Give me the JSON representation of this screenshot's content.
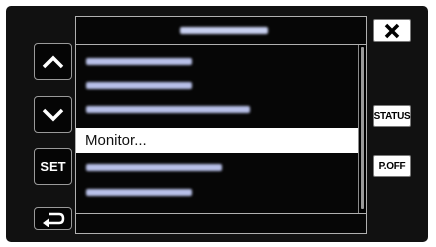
{
  "header": {
    "title": ""
  },
  "sidebar": {
    "up_label": "",
    "down_label": "",
    "set_label": "SET",
    "back_label": ""
  },
  "right": {
    "close_label": "",
    "status_label": "STATUS",
    "poff_label": "P.OFF"
  },
  "menu": {
    "items": [
      {
        "label": ""
      },
      {
        "label": ""
      },
      {
        "label": ""
      },
      {
        "label": "Monitor..."
      },
      {
        "label": ""
      },
      {
        "label": ""
      }
    ],
    "selected_index": 3
  },
  "colors": {
    "panel_bg": "#111111",
    "selection_bg": "#ffffff",
    "blurred_text": "#c8d0f0"
  },
  "icons": [
    "up-arrow-icon",
    "down-arrow-icon",
    "back-arrow-icon",
    "close-icon"
  ]
}
